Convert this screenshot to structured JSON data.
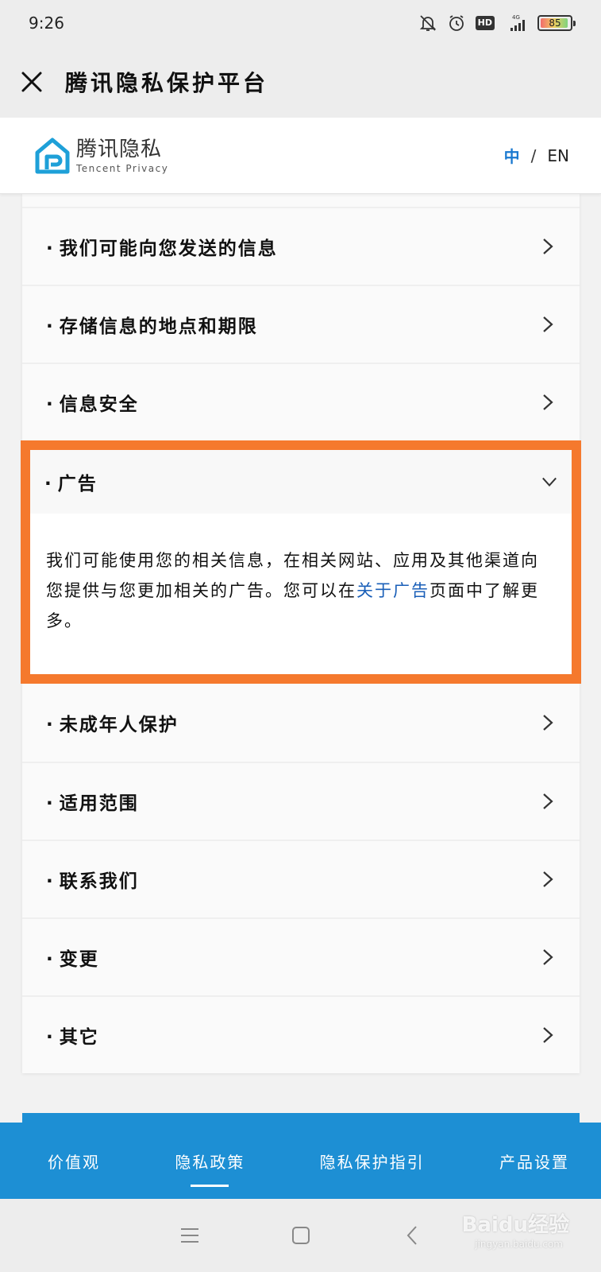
{
  "status": {
    "time": "9:26",
    "hd": "HD",
    "network": "4G",
    "battery_level": "85"
  },
  "nav": {
    "title": "腾讯隐私保护平台"
  },
  "header": {
    "logo_cn": "腾讯隐私",
    "logo_en": "Tencent Privacy",
    "lang_zh": "中",
    "lang_sep": "/",
    "lang_en": "EN"
  },
  "sections": {
    "items_before": [
      {
        "bullet": "·",
        "label": "我们可能向您发送的信息"
      },
      {
        "bullet": "·",
        "label": "存储信息的地点和期限"
      },
      {
        "bullet": "·",
        "label": "信息安全"
      }
    ],
    "expanded": {
      "bullet": "·",
      "label": "广告",
      "body_text_1": "我们可能使用您的相关信息，在相关网站、应用及其他渠道向您提供与您更加相关的广告。您可以在",
      "link_text": "关于广告",
      "body_text_2": "页面中了解更多。"
    },
    "items_after": [
      {
        "bullet": "·",
        "label": "未成年人保护"
      },
      {
        "bullet": "·",
        "label": "适用范围"
      },
      {
        "bullet": "·",
        "label": "联系我们"
      },
      {
        "bullet": "·",
        "label": "变更"
      },
      {
        "bullet": "·",
        "label": "其它"
      }
    ]
  },
  "tabs": [
    {
      "label": "价值观"
    },
    {
      "label": "隐私政策"
    },
    {
      "label": "隐私保护指引"
    },
    {
      "label": "产品设置"
    }
  ],
  "watermark": {
    "brand": "Baidu经验",
    "site": "jingyan.baidu.com"
  },
  "colors": {
    "accent": "#1d8fd4",
    "highlight_border": "#f5792d",
    "link": "#1a5fb8"
  }
}
